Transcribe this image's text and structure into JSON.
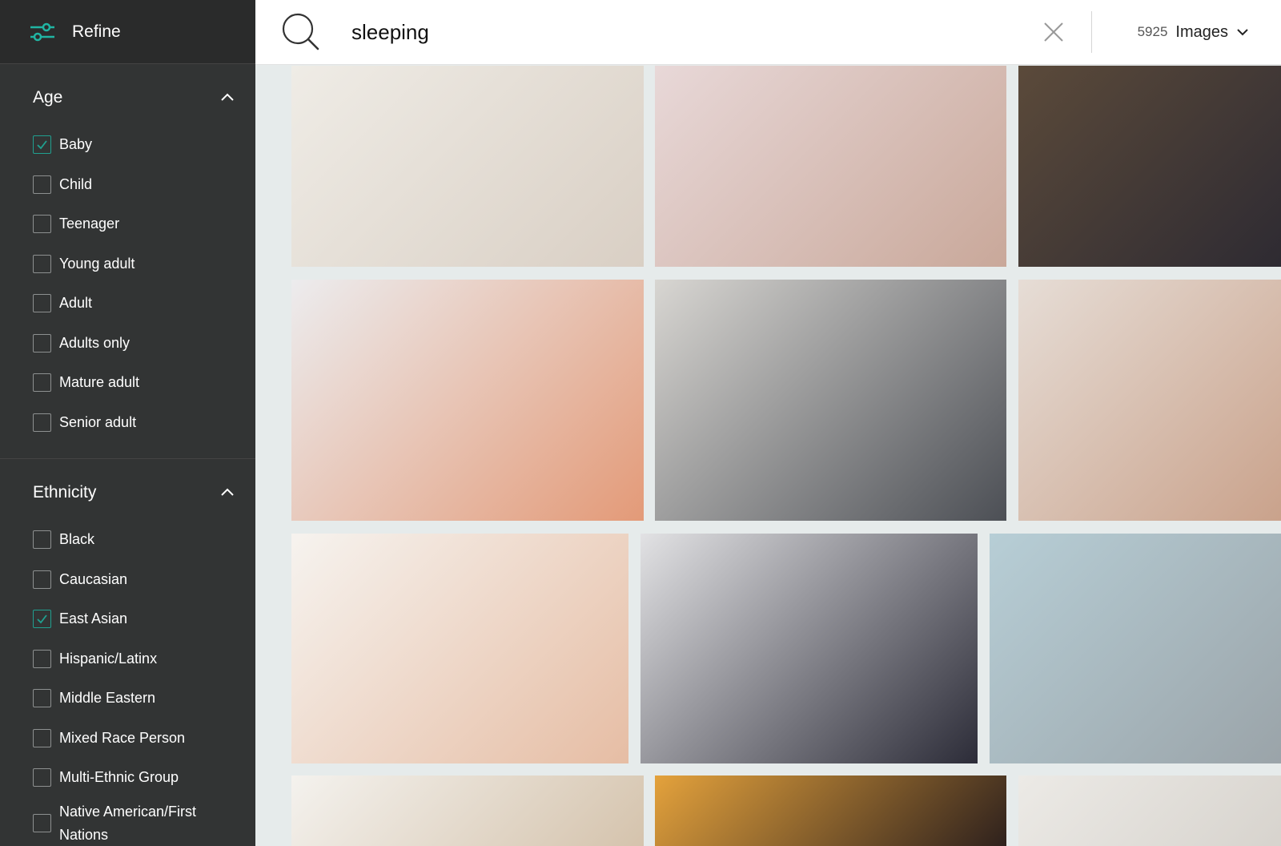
{
  "sidebar": {
    "refine_label": "Refine",
    "age": {
      "title": "Age",
      "options": [
        {
          "label": "Baby",
          "checked": true
        },
        {
          "label": "Child",
          "checked": false
        },
        {
          "label": "Teenager",
          "checked": false
        },
        {
          "label": "Young adult",
          "checked": false
        },
        {
          "label": "Adult",
          "checked": false
        },
        {
          "label": "Adults only",
          "checked": false
        },
        {
          "label": "Mature adult",
          "checked": false
        },
        {
          "label": "Senior adult",
          "checked": false
        }
      ]
    },
    "ethnicity": {
      "title": "Ethnicity",
      "options": [
        {
          "label": "Black",
          "checked": false
        },
        {
          "label": "Caucasian",
          "checked": false
        },
        {
          "label": "East Asian",
          "checked": true
        },
        {
          "label": "Hispanic/Latinx",
          "checked": false
        },
        {
          "label": "Middle Eastern",
          "checked": false
        },
        {
          "label": "Mixed Race Person",
          "checked": false
        },
        {
          "label": "Multi-Ethnic Group",
          "checked": false
        },
        {
          "label": "Native American/First Nations",
          "checked": false
        }
      ]
    }
  },
  "search": {
    "query": "sleeping",
    "result_count": "5925",
    "type_label": "Images"
  },
  "colors": {
    "sidebar_bg": "#323434",
    "accent": "#20a090",
    "grid_bg": "#e6ebeb"
  },
  "images": [
    {
      "colors": [
        "#efece6",
        "#d9cfc4"
      ]
    },
    {
      "colors": [
        "#e8d8d8",
        "#c9a89a"
      ]
    },
    {
      "colors": [
        "#5b4a3a",
        "#2d2a32"
      ]
    },
    {
      "colors": [
        "#ececee",
        "#e39a78"
      ]
    },
    {
      "colors": [
        "#d8d6d2",
        "#4c4f55"
      ]
    },
    {
      "colors": [
        "#e6ddd6",
        "#c9a18a"
      ]
    },
    {
      "colors": [
        "#f6f3ef",
        "#e6bda4"
      ]
    },
    {
      "colors": [
        "#e2e2e4",
        "#2c2c38"
      ]
    },
    {
      "colors": [
        "#b7ced6",
        "#9aa3a8"
      ]
    },
    {
      "colors": [
        "#f4f2ee",
        "#d4c2ab"
      ]
    },
    {
      "colors": [
        "#e4a23c",
        "#2a1e1c"
      ]
    },
    {
      "colors": [
        "#eceae6",
        "#d6d2cc"
      ]
    }
  ]
}
